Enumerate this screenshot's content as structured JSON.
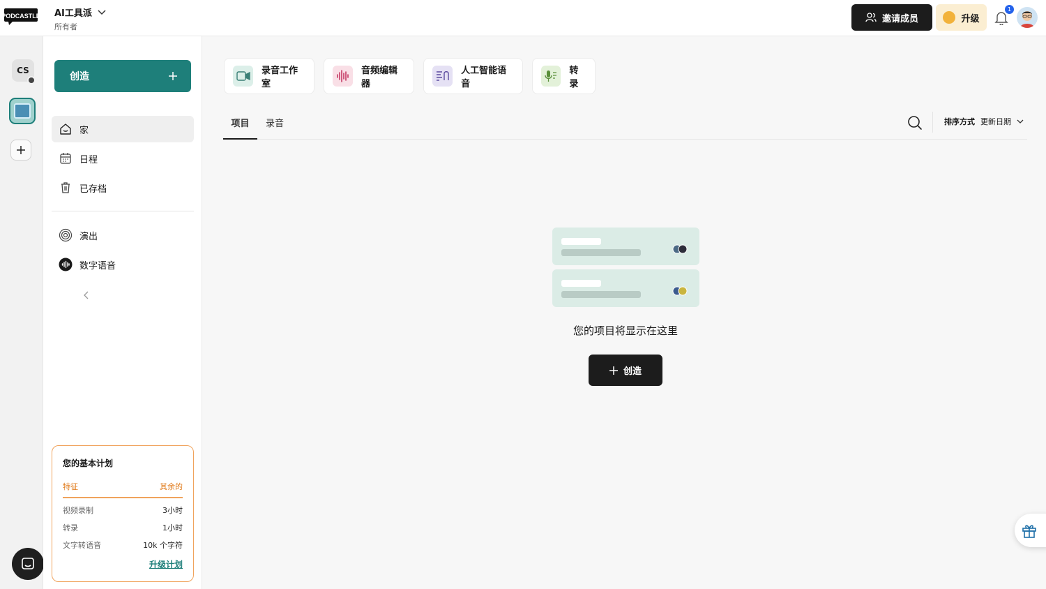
{
  "app": {
    "logo_text": "PODCASTLE"
  },
  "workspace": {
    "name": "AI工具派",
    "role": "所有者"
  },
  "header": {
    "invite_label": "邀请成员",
    "upgrade_label": "升级",
    "notification_count": "1"
  },
  "rail": {
    "workspace_initials": "CS"
  },
  "sidebar": {
    "create_label": "创造",
    "items": [
      {
        "label": "家",
        "icon": "home-icon"
      },
      {
        "label": "日程",
        "icon": "calendar-icon"
      },
      {
        "label": "已存档",
        "icon": "trash-icon"
      },
      {
        "label": "演出",
        "icon": "podcast-icon"
      },
      {
        "label": "数字语音",
        "icon": "waveform-icon"
      }
    ]
  },
  "plan": {
    "title": "您的基本计划",
    "col_feature": "特征",
    "col_remaining": "其余的",
    "rows": [
      {
        "feature": "视频录制",
        "remaining": "3小时"
      },
      {
        "feature": "转录",
        "remaining": "1小时"
      },
      {
        "feature": "文字转语音",
        "remaining": "10k 个字符"
      }
    ],
    "upgrade_link": "升级计划"
  },
  "tools": [
    {
      "label": "录音工作室",
      "icon": "video-camera-icon"
    },
    {
      "label": "音频编辑器",
      "icon": "audio-wave-icon"
    },
    {
      "label": "人工智能语音",
      "icon": "ai-voice-icon"
    },
    {
      "label": "转录",
      "icon": "transcribe-icon"
    }
  ],
  "tabs": [
    {
      "label": "项目"
    },
    {
      "label": "录音"
    }
  ],
  "sort": {
    "label": "排序方式",
    "value": "更新日期"
  },
  "empty": {
    "message": "您的项目将显示在这里",
    "create_label": "创造"
  },
  "colors": {
    "accent": "#1e7f7a",
    "plan_border": "#f0a35c",
    "dark": "#1c1c1c"
  }
}
